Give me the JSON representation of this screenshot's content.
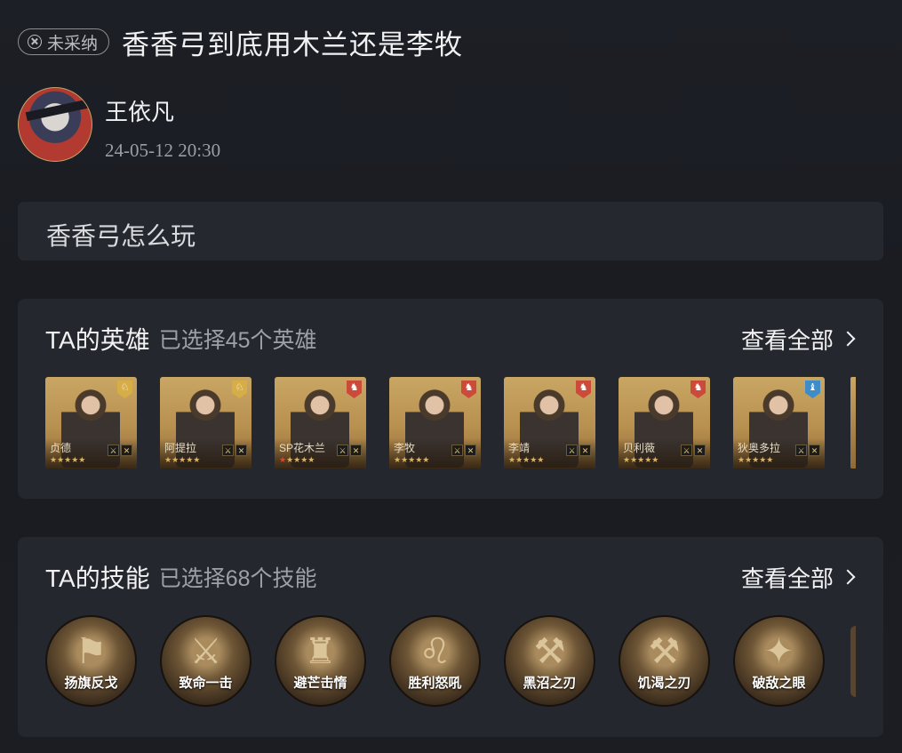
{
  "header": {
    "status_badge": "未采纳",
    "title": "香香弓到底用木兰还是李牧"
  },
  "author": {
    "name": "王依凡",
    "time": "24-05-12 20:30"
  },
  "question": "香香弓怎么玩",
  "heroes_section": {
    "title": "TA的英雄",
    "subtitle": "已选择45个英雄",
    "view_all": "查看全部",
    "heroes": [
      {
        "name": "贞德",
        "stars": "★★★★★",
        "crest": "gold",
        "crest_icon": "♘"
      },
      {
        "name": "阿提拉",
        "stars": "★★★★★",
        "crest": "gold",
        "crest_icon": "♘"
      },
      {
        "name": "SP花木兰",
        "stars": "★★★★",
        "red_star": "★",
        "crest": "red",
        "crest_icon": "♞"
      },
      {
        "name": "李牧",
        "stars": "★★★★★",
        "crest": "red",
        "crest_icon": "♞"
      },
      {
        "name": "李靖",
        "stars": "★★★★★",
        "crest": "red",
        "crest_icon": "♞"
      },
      {
        "name": "贝利薇",
        "stars": "★★★★★",
        "crest": "red",
        "crest_icon": "♞"
      },
      {
        "name": "狄奥多拉",
        "stars": "★★★★★",
        "crest": "blue",
        "crest_icon": "♝"
      }
    ]
  },
  "skills_section": {
    "title": "TA的技能",
    "subtitle": "已选择68个技能",
    "view_all": "查看全部",
    "skills": [
      {
        "name": "扬旗反戈",
        "icon": "flag-icon"
      },
      {
        "name": "致命一击",
        "icon": "sword-strike-icon"
      },
      {
        "name": "避芒击惰",
        "icon": "warrior-icon"
      },
      {
        "name": "胜利怒吼",
        "icon": "lion-icon"
      },
      {
        "name": "黑沼之刃",
        "icon": "blade-icon"
      },
      {
        "name": "饥渴之刃",
        "icon": "blade-icon"
      },
      {
        "name": "破敌之眼",
        "icon": "eagle-icon"
      }
    ]
  }
}
